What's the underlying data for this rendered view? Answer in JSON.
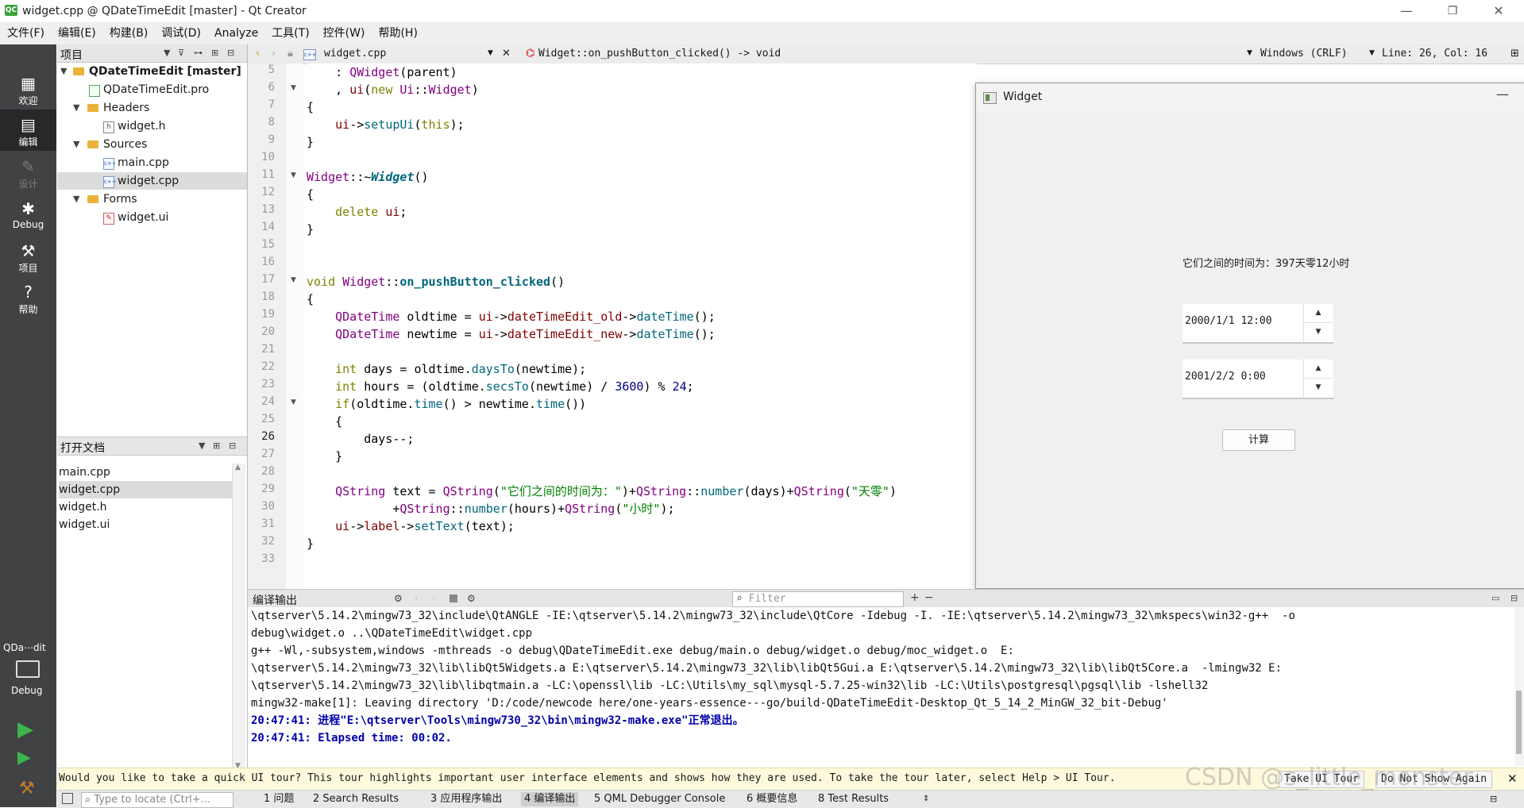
{
  "window": {
    "title": "widget.cpp @ QDateTimeEdit [master] - Qt Creator",
    "app_icon": "QC"
  },
  "menu": [
    "文件(F)",
    "编辑(E)",
    "构建(B)",
    "调试(D)",
    "Analyze",
    "工具(T)",
    "控件(W)",
    "帮助(H)"
  ],
  "modes": [
    {
      "label": "欢迎",
      "icon": "grid-icon"
    },
    {
      "label": "编辑",
      "icon": "edit-icon"
    },
    {
      "label": "设计",
      "icon": "pen-icon"
    },
    {
      "label": "Debug",
      "icon": "bug-icon"
    },
    {
      "label": "项目",
      "icon": "wrench-icon"
    },
    {
      "label": "帮助",
      "icon": "help-icon"
    }
  ],
  "kit": {
    "name": "QDa⋯dit",
    "build": "Debug"
  },
  "project_panel": {
    "title": "项目",
    "tree": [
      "QDateTimeEdit [master]",
      "QDateTimeEdit.pro",
      "Headers",
      "widget.h",
      "Sources",
      "main.cpp",
      "widget.cpp",
      "Forms",
      "widget.ui"
    ]
  },
  "open_docs": {
    "title": "打开文档",
    "files": [
      "main.cpp",
      "widget.cpp",
      "widget.h",
      "widget.ui"
    ]
  },
  "editor": {
    "file": "widget.cpp",
    "symbol": "Widget::on_pushButton_clicked() -> void",
    "encoding": "Windows (CRLF)",
    "position": "Line: 26, Col: 16",
    "current_line": "26",
    "line_numbers": [
      "5",
      "6",
      "7",
      "8",
      "9",
      "10",
      "11",
      "12",
      "13",
      "14",
      "15",
      "16",
      "17",
      "18",
      "19",
      "20",
      "21",
      "22",
      "23",
      "24",
      "25",
      "26",
      "27",
      "28",
      "29",
      "30",
      "31",
      "32",
      "33"
    ]
  },
  "widget_window": {
    "title": "Widget",
    "label": "它们之间的时间为：397天零12小时",
    "old_datetime": "2000/1/1 12:00",
    "new_datetime": "2001/2/2 0:00",
    "button": "计算"
  },
  "compile_output": {
    "title": "编译输出",
    "filter_placeholder": "Filter",
    "lines": [
      "\\qtserver\\5.14.2\\mingw73_32\\include\\QtANGLE -IE:\\qtserver\\5.14.2\\mingw73_32\\include\\QtCore -Idebug -I. -IE:\\qtserver\\5.14.2\\mingw73_32\\mkspecs\\win32-g++  -o",
      "debug\\widget.o ..\\QDateTimeEdit\\widget.cpp",
      "g++ -Wl,-subsystem,windows -mthreads -o debug\\QDateTimeEdit.exe debug/main.o debug/widget.o debug/moc_widget.o  E:",
      "\\qtserver\\5.14.2\\mingw73_32\\lib\\libQt5Widgets.a E:\\qtserver\\5.14.2\\mingw73_32\\lib\\libQt5Gui.a E:\\qtserver\\5.14.2\\mingw73_32\\lib\\libQt5Core.a  -lmingw32 E:",
      "\\qtserver\\5.14.2\\mingw73_32\\lib\\libqtmain.a -LC:\\openssl\\lib -LC:\\Utils\\my_sql\\mysql-5.7.25-win32\\lib -LC:\\Utils\\postgresql\\pgsql\\lib -lshell32",
      "mingw32-make[1]: Leaving directory 'D:/code/newcode here/one-years-essence---go/build-QDateTimeEdit-Desktop_Qt_5_14_2_MinGW_32_bit-Debug'"
    ],
    "status_lines": [
      "20:47:41: 进程\"E:\\qtserver\\Tools\\mingw730_32\\bin\\mingw32-make.exe\"正常退出。",
      "20:47:41: Elapsed time: 00:02."
    ]
  },
  "info_bar": {
    "text": "Would you like to take a quick UI tour? This tour highlights important user interface elements and shows how they are used. To take the tour later, select Help > UI Tour.",
    "take_tour": "Take UI Tour",
    "dont_show": "Do Not Show Again"
  },
  "status_bar": {
    "locator_placeholder": "Type to locate (Ctrl+...",
    "tabs": [
      "1 问题",
      "2 Search Results",
      "3 应用程序输出",
      "4 编译输出",
      "5 QML Debugger Console",
      "6 概要信息",
      "8 Test Results"
    ]
  },
  "watermark": "CSDN @s_little_monster"
}
